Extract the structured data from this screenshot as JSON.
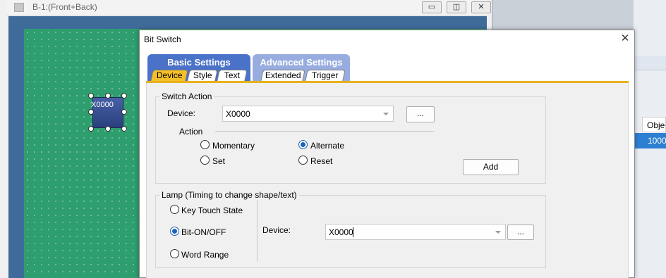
{
  "editor": {
    "title": "B-1:(Front+Back)",
    "object_label": "X0000"
  },
  "right_panel": {
    "column_header": "Obje",
    "selected_row": "1000"
  },
  "dialog": {
    "title": "Bit Switch",
    "tab_groups": [
      {
        "label": "Basic Settings",
        "tabs": [
          "Device",
          "Style",
          "Text"
        ],
        "active": "Device"
      },
      {
        "label": "Advanced Settings",
        "tabs": [
          "Extended",
          "Trigger"
        ]
      }
    ],
    "switch_action": {
      "legend": "Switch Action",
      "device_label": "Device:",
      "device_value": "X0000",
      "browse_label": "...",
      "action_label": "Action",
      "options": [
        {
          "label": "Momentary",
          "checked": false
        },
        {
          "label": "Alternate",
          "checked": true
        },
        {
          "label": "Set",
          "checked": false
        },
        {
          "label": "Reset",
          "checked": false
        }
      ],
      "add_label": "Add"
    },
    "lamp": {
      "legend": "Lamp (Timing to change shape/text)",
      "options": [
        {
          "label": "Key Touch State",
          "checked": false
        },
        {
          "label": "Bit-ON/OFF",
          "checked": true
        },
        {
          "label": "Word Range",
          "checked": false
        }
      ],
      "device_label": "Device:",
      "device_value": "X0000",
      "browse_label": "..."
    }
  },
  "icons": {
    "close": "close-icon",
    "minimize": "minimize-icon",
    "maximize": "maximize-icon",
    "dropdown": "chevron-down-icon"
  },
  "colors": {
    "canvas": "#2f9e6f",
    "basic_tab": "#4a72c8",
    "advanced_tab": "#98ace0",
    "active_subtab": "#f5bf28",
    "selection": "#2d7fd2"
  }
}
